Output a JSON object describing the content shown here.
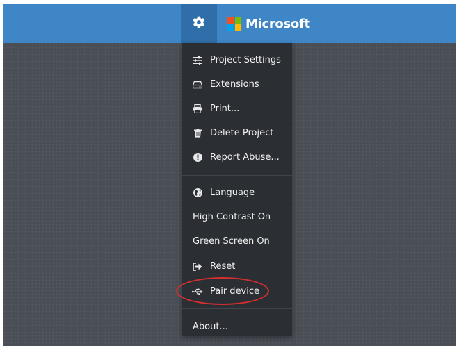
{
  "header": {
    "brand_name": "Microsoft",
    "brand_colors": [
      "#f25022",
      "#7fba00",
      "#00a4ef",
      "#ffb900"
    ],
    "bar_color": "#3e86c6",
    "gear_icon": "gear-icon"
  },
  "settings_menu": {
    "items": [
      {
        "label": "Project Settings",
        "icon": "sliders-icon"
      },
      {
        "label": "Extensions",
        "icon": "drive-icon"
      },
      {
        "label": "Print...",
        "icon": "printer-icon"
      },
      {
        "label": "Delete Project",
        "icon": "trash-icon"
      },
      {
        "label": "Report Abuse...",
        "icon": "exclamation-circle-icon"
      },
      {
        "label": "Language",
        "icon": "globe-icon"
      },
      {
        "label": "High Contrast On",
        "icon": ""
      },
      {
        "label": "Green Screen On",
        "icon": ""
      },
      {
        "label": "Reset",
        "icon": "sign-out-icon"
      },
      {
        "label": "Pair device",
        "icon": "usb-icon"
      },
      {
        "label": "About...",
        "icon": ""
      }
    ]
  },
  "annotation": {
    "highlight_color": "#d32f2f",
    "highlighted_item": "Pair device"
  }
}
